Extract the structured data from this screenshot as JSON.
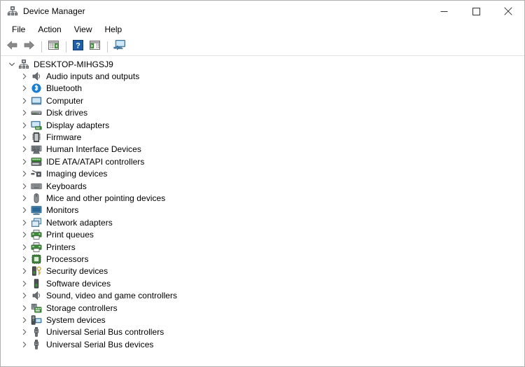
{
  "window": {
    "title": "Device Manager",
    "title_icon": "device-manager-icon",
    "controls": {
      "minimize": "minimize-icon",
      "maximize": "maximize-icon",
      "close": "close-icon"
    }
  },
  "menubar": {
    "items": [
      {
        "label": "File"
      },
      {
        "label": "Action"
      },
      {
        "label": "View"
      },
      {
        "label": "Help"
      }
    ]
  },
  "toolbar": {
    "buttons": [
      {
        "name": "back-button",
        "icon": "back-arrow-icon"
      },
      {
        "name": "forward-button",
        "icon": "forward-arrow-icon"
      },
      {
        "name": "separator-1",
        "icon": "separator"
      },
      {
        "name": "properties-button",
        "icon": "properties-window-icon"
      },
      {
        "name": "separator-2",
        "icon": "separator"
      },
      {
        "name": "help-button",
        "icon": "help-question-icon"
      },
      {
        "name": "scan-hardware-button",
        "icon": "scan-window-icon"
      },
      {
        "name": "separator-3",
        "icon": "separator"
      },
      {
        "name": "update-driver-button",
        "icon": "monitor-update-icon"
      }
    ]
  },
  "tree": {
    "root": {
      "label": "DESKTOP-MIHGSJ9",
      "icon": "computer-tree-icon",
      "expanded": true
    },
    "items": [
      {
        "label": "Audio inputs and outputs",
        "icon": "speaker-icon"
      },
      {
        "label": "Bluetooth",
        "icon": "bluetooth-icon"
      },
      {
        "label": "Computer",
        "icon": "computer-monitor-icon"
      },
      {
        "label": "Disk drives",
        "icon": "disk-drive-icon"
      },
      {
        "label": "Display adapters",
        "icon": "display-adapter-icon"
      },
      {
        "label": "Firmware",
        "icon": "firmware-chip-icon"
      },
      {
        "label": "Human Interface Devices",
        "icon": "hid-keypad-icon"
      },
      {
        "label": "IDE ATA/ATAPI controllers",
        "icon": "ide-controller-icon"
      },
      {
        "label": "Imaging devices",
        "icon": "camera-icon"
      },
      {
        "label": "Keyboards",
        "icon": "keyboard-icon"
      },
      {
        "label": "Mice and other pointing devices",
        "icon": "mouse-icon"
      },
      {
        "label": "Monitors",
        "icon": "monitor-icon"
      },
      {
        "label": "Network adapters",
        "icon": "network-card-icon"
      },
      {
        "label": "Print queues",
        "icon": "printer-icon"
      },
      {
        "label": "Printers",
        "icon": "printer-icon"
      },
      {
        "label": "Processors",
        "icon": "processor-chip-icon"
      },
      {
        "label": "Security devices",
        "icon": "security-key-icon"
      },
      {
        "label": "Software devices",
        "icon": "software-device-icon"
      },
      {
        "label": "Sound, video and game controllers",
        "icon": "speaker-icon"
      },
      {
        "label": "Storage controllers",
        "icon": "storage-controller-icon"
      },
      {
        "label": "System devices",
        "icon": "system-device-icon"
      },
      {
        "label": "Universal Serial Bus controllers",
        "icon": "usb-icon"
      },
      {
        "label": "Universal Serial Bus devices",
        "icon": "usb-icon"
      }
    ]
  },
  "colors": {
    "window_bg": "#ffffff",
    "text": "#000000",
    "chevron": "#6d6d6d",
    "toolbar_border": "#e2e2e2",
    "bluetooth_blue": "#1a7fd4",
    "help_blue": "#1e5fa8",
    "monitor_blue": "#5aa9dd",
    "arrow_gray": "#7a7a7a"
  }
}
